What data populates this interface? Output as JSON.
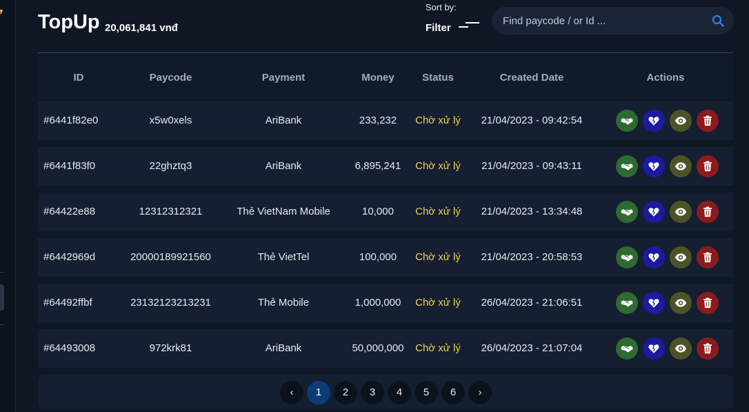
{
  "header": {
    "title": "TopUp",
    "balance": "20,061,841 vnđ",
    "sort_label": "Sort by:",
    "filter_label": "Filter",
    "search_placeholder": "Find paycode / or Id ..."
  },
  "table": {
    "columns": [
      "ID",
      "Paycode",
      "Payment",
      "Money",
      "Status",
      "Created Date",
      "Actions"
    ],
    "rows": [
      {
        "id": "#6441f82e0",
        "paycode": "x5w0xels",
        "payment": "AriBank",
        "money": "233,232",
        "status": "Chờ xử lý",
        "date": "21/04/2023 - 09:42:54"
      },
      {
        "id": "#6441f83f0",
        "paycode": "22ghztq3",
        "payment": "AriBank",
        "money": "6,895,241",
        "status": "Chờ xử lý",
        "date": "21/04/2023 - 09:43:11"
      },
      {
        "id": "#64422e88",
        "paycode": "12312312321",
        "payment": "Thẻ VietNam Mobile",
        "money": "10,000",
        "status": "Chờ xử lý",
        "date": "21/04/2023 - 13:34:48"
      },
      {
        "id": "#6442969d",
        "paycode": "20000189921560",
        "payment": "Thẻ VietTel",
        "money": "100,000",
        "status": "Chờ xử lý",
        "date": "21/04/2023 - 20:58:53"
      },
      {
        "id": "#64492ffbf",
        "paycode": "23132123213231",
        "payment": "Thẻ Mobile",
        "money": "1,000,000",
        "status": "Chờ xử lý",
        "date": "26/04/2023 - 21:06:51"
      },
      {
        "id": "#64493008",
        "paycode": "972krk81",
        "payment": "AriBank",
        "money": "50,000,000",
        "status": "Chờ xử lý",
        "date": "26/04/2023 - 21:07:04"
      }
    ]
  },
  "actions": [
    {
      "icon": "handshake-icon",
      "color": "#2e6b32"
    },
    {
      "icon": "heart-broken-icon",
      "color": "#1c1aa0"
    },
    {
      "icon": "eye-icon",
      "color": "#4c5427"
    },
    {
      "icon": "trash-icon",
      "color": "#8c1c1c"
    }
  ],
  "pagination": {
    "prev": "‹",
    "next": "›",
    "pages": [
      "1",
      "2",
      "3",
      "4",
      "5",
      "6"
    ],
    "current": "1"
  },
  "colors": {
    "background": "#0f1724",
    "row": "#151f31",
    "status": "#f3d248",
    "search_icon": "#2f7ff0",
    "accent": "#f2c11c"
  }
}
